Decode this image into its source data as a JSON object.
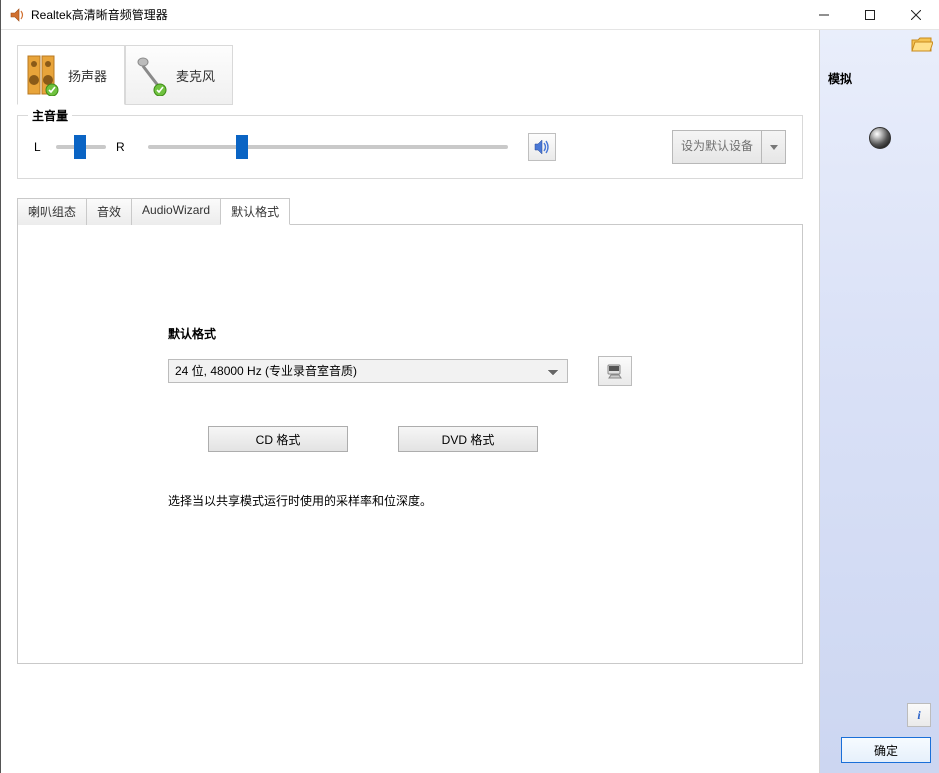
{
  "title": "Realtek高清晰音频管理器",
  "device_tabs": {
    "speakers": "扬声器",
    "microphone": "麦克风"
  },
  "main_volume": {
    "legend": "主音量",
    "left_label": "L",
    "right_label": "R"
  },
  "default_device_btn": "设为默认设备",
  "subtabs": {
    "config": "喇叭组态",
    "effects": "音效",
    "wizard": "AudioWizard",
    "default_format": "默认格式"
  },
  "format_section": {
    "heading": "默认格式",
    "selected": "24 位, 48000 Hz (专业录音室音质)",
    "cd_btn": "CD 格式",
    "dvd_btn": "DVD 格式",
    "description": "选择当以共享模式运行时使用的采样率和位深度。"
  },
  "side": {
    "label": "模拟"
  },
  "footer": {
    "info": "i",
    "ok": "确定"
  }
}
